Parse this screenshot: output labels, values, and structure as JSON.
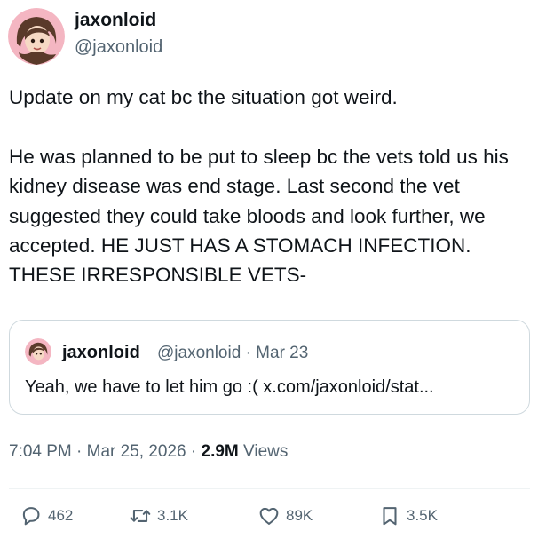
{
  "author": {
    "display_name": "jaxonloid",
    "handle": "@jaxonloid"
  },
  "tweet": {
    "text": "Update on my cat bc the situation got weird.\n\nHe was planned to be put to sleep bc the vets told us his kidney disease was end stage. Last second the vet suggested they could take bloods and look further, we accepted. HE JUST HAS A STOMACH INFECTION. THESE IRRESPONSIBLE VETS-"
  },
  "quote": {
    "display_name": "jaxonloid",
    "meta": "@jaxonloid · Mar 23",
    "text": "Yeah, we have to let him go :( x.com/jaxonloid/stat..."
  },
  "meta": {
    "time": "7:04 PM",
    "date": "Mar 25, 2026",
    "views_count": "2.9M",
    "views_label": "Views",
    "sep": "·"
  },
  "actions": {
    "replies": {
      "icon": "reply-icon",
      "count": "462"
    },
    "retweets": {
      "icon": "retweet-icon",
      "count": "3.1K"
    },
    "likes": {
      "icon": "heart-icon",
      "count": "89K"
    },
    "bookmarks": {
      "icon": "bookmark-icon",
      "count": "3.5K"
    }
  },
  "colors": {
    "text": "#0f1419",
    "secondary": "#536471",
    "border": "#cfd9de",
    "avatar_bg": "#f4b6c2"
  }
}
